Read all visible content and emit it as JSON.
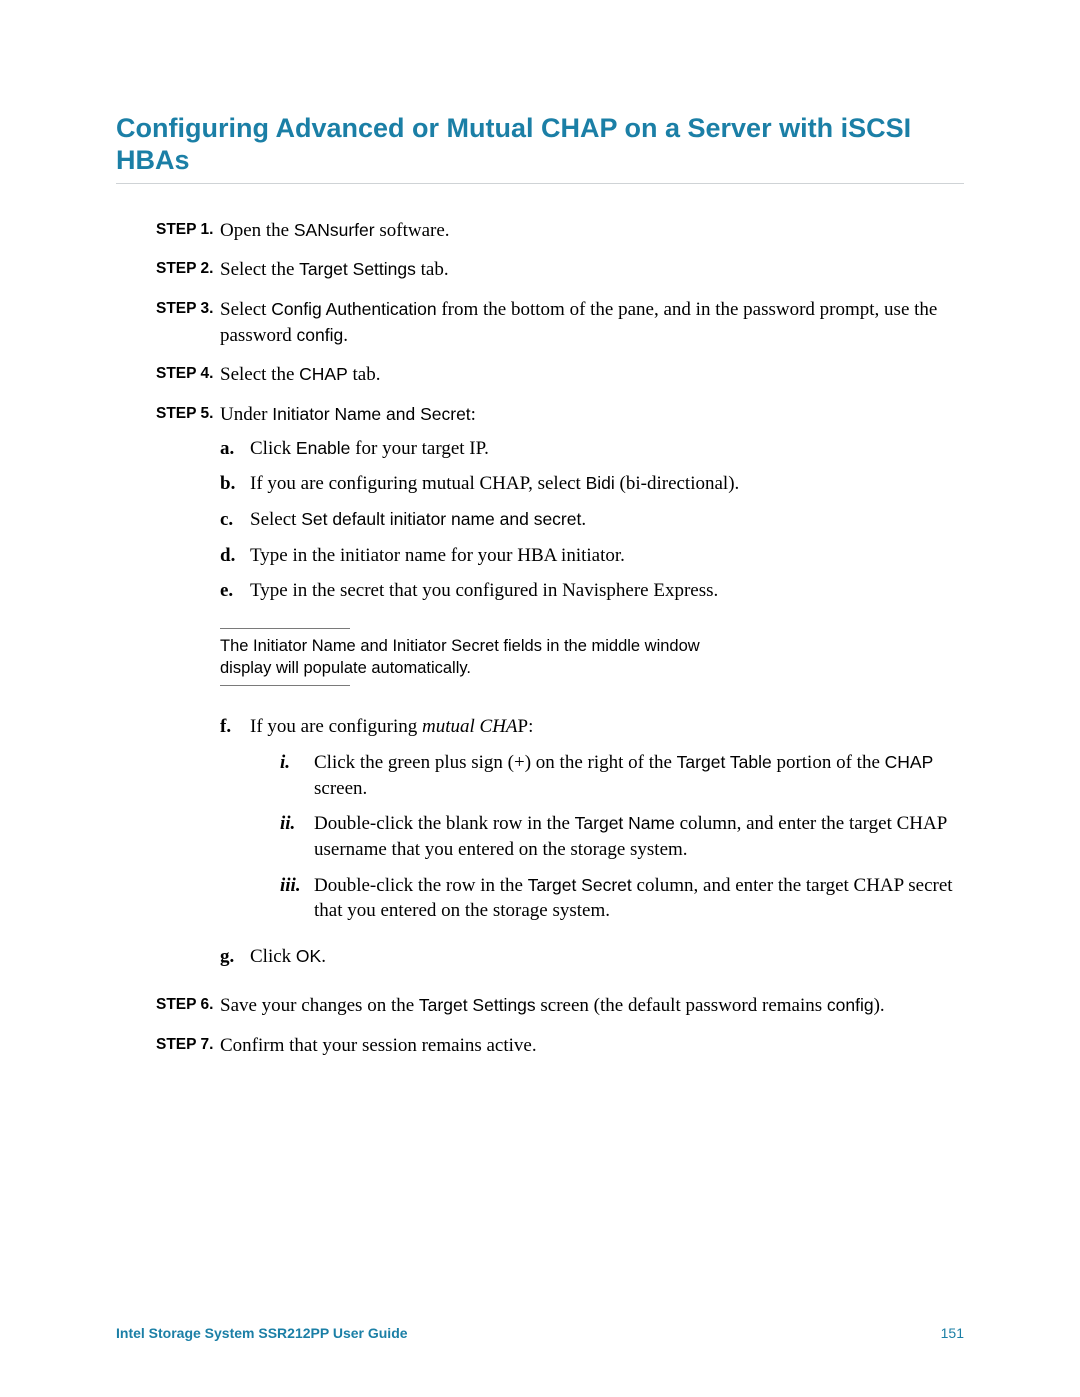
{
  "title": "Configuring Advanced or Mutual CHAP on a Server with iSCSI HBAs",
  "labels": {
    "step1": "STEP 1.",
    "step2": "STEP 2.",
    "step3": "STEP 3.",
    "step4": "STEP 4.",
    "step5": "STEP 5.",
    "step6": "STEP 6.",
    "step7": "STEP 7.",
    "a": "a.",
    "b": "b.",
    "c": "c.",
    "d": "d.",
    "e": "e.",
    "f": "f.",
    "g": "g.",
    "i": "i.",
    "ii": "ii.",
    "iii": "iii."
  },
  "step1": {
    "pre": "Open the ",
    "ui1": "SANsurfer",
    "post": " software."
  },
  "step2": {
    "pre": "Select the ",
    "ui1": "Target Settings",
    "post": " tab."
  },
  "step3": {
    "pre": "Select ",
    "ui1": "Config Authentication",
    "mid": " from the bottom of the pane, and in the password prompt, use the password ",
    "ui2": "config",
    "post": "."
  },
  "step4": {
    "pre": "Select the ",
    "ui1": "CHAP",
    "post": " tab."
  },
  "step5": {
    "intro_pre": "Under ",
    "intro_ui1": "Initiator Name and Secret",
    "intro_post": ":",
    "a": {
      "pre": "Click ",
      "ui1": "Enable",
      "post": " for your target IP."
    },
    "b": {
      "pre": "If you are configuring mutual CHAP, select ",
      "ui1": "Bidi",
      "post": " (bi-directional)."
    },
    "c": {
      "pre": "Select ",
      "ui1": "Set default initiator name and secret",
      "post": "."
    },
    "d": {
      "text": "Type in the initiator name for your HBA initiator."
    },
    "e": {
      "text": "Type in the secret that you configured in Navisphere Express."
    },
    "note": {
      "pre": "The ",
      "ui1": "Initiator Name",
      "mid1": " and ",
      "ui2": "Initiator Secret",
      "post": " fields in the middle window display will populate automatically."
    },
    "f": {
      "pre": "If you are configuring ",
      "ital": "mutual CHA",
      "post": "P:",
      "i": {
        "pre": "Click the green plus sign (+) on the right of the ",
        "ui1": "Target Table",
        "mid": " portion of the ",
        "ui2": "CHAP",
        "post": " screen."
      },
      "ii": {
        "pre": "Double-click the blank row in the ",
        "ui1": "Target Name",
        "post": " column, and enter the target CHAP username that you entered on the storage system."
      },
      "iii": {
        "pre": "Double-click the row in the ",
        "ui1": "Target Secret",
        "post": " column, and enter the target CHAP secret that you entered on the storage system."
      }
    },
    "g": {
      "pre": "Click ",
      "ui1": "OK",
      "post": "."
    }
  },
  "step6": {
    "pre": "Save your changes on the ",
    "ui1": "Target Settings",
    "mid": " screen (the default password remains ",
    "ui2": "config",
    "post": ")."
  },
  "step7": {
    "text": "Confirm that your session remains active."
  },
  "footer": {
    "title": "Intel Storage System SSR212PP User Guide",
    "page": "151"
  }
}
